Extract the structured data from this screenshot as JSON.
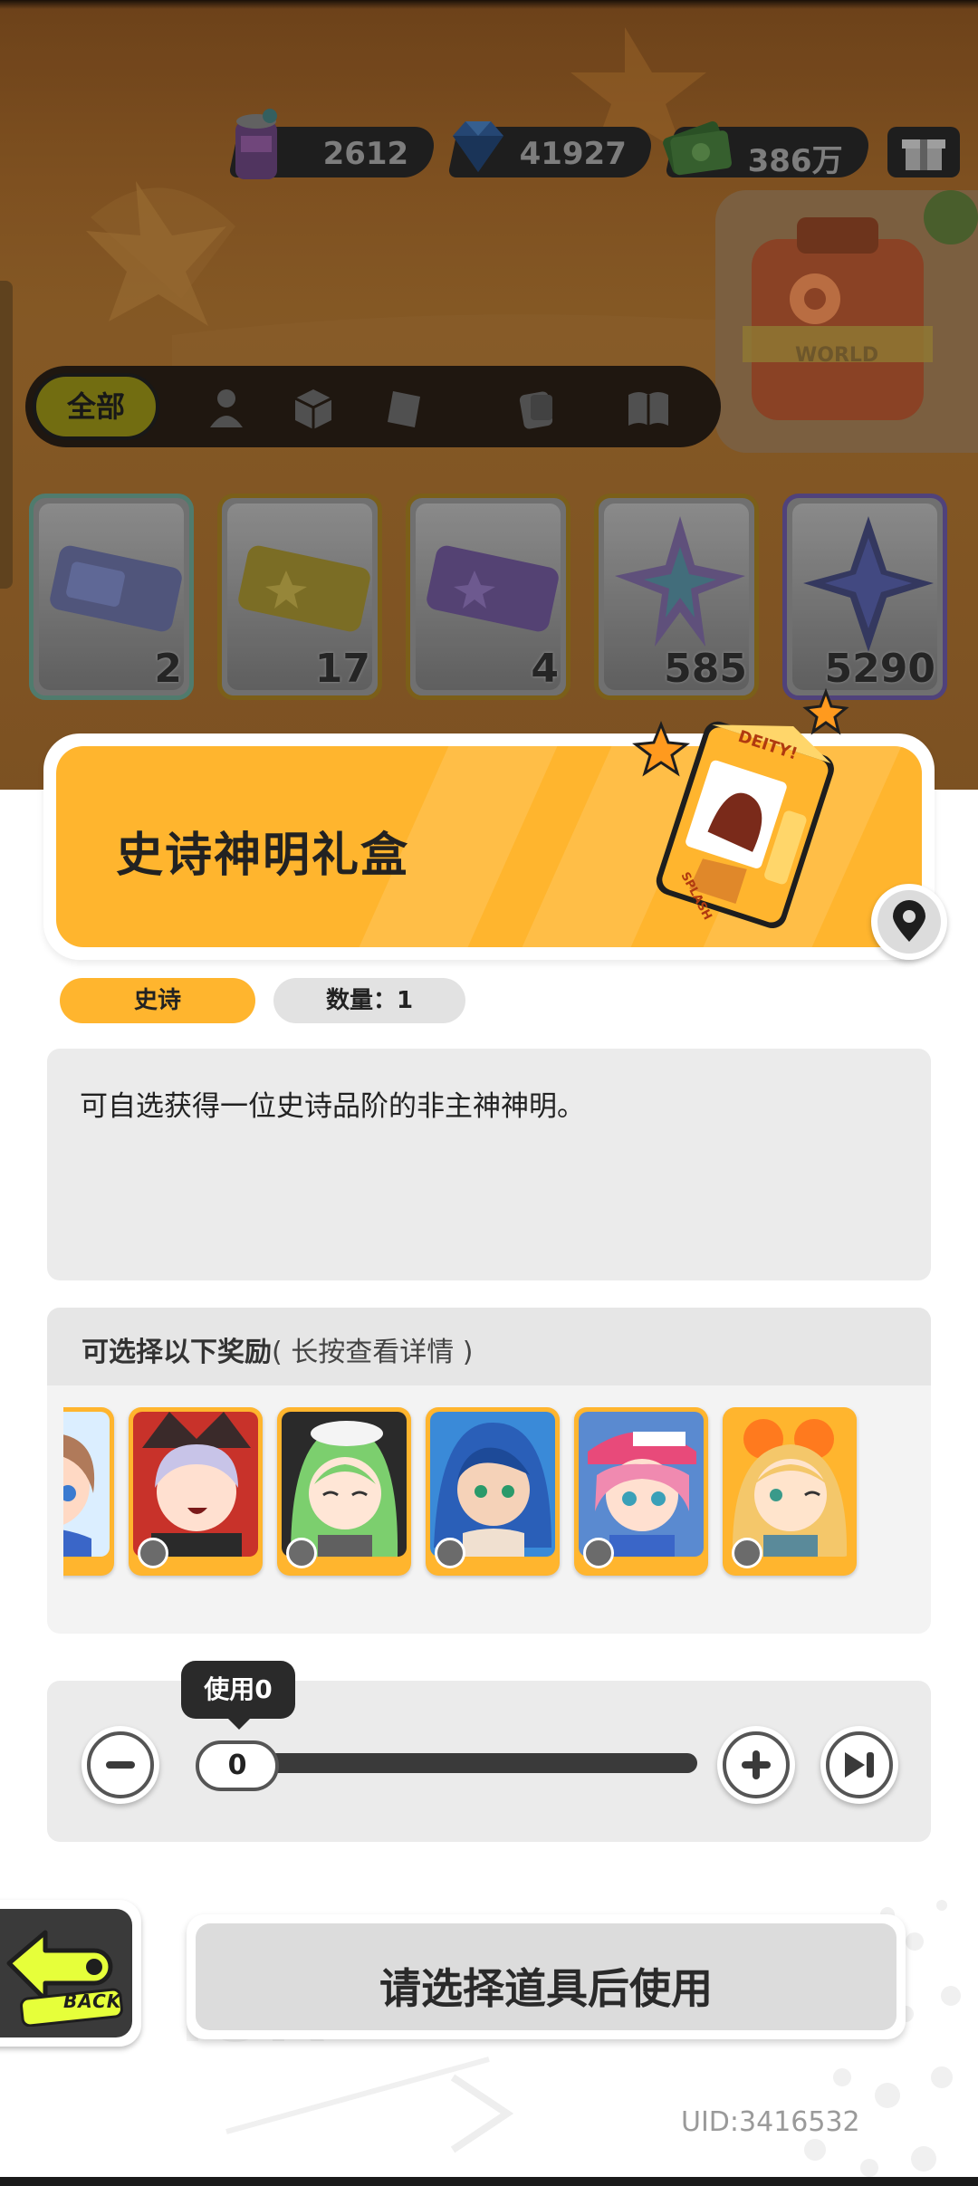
{
  "currencies": [
    {
      "icon": "soda-can-icon",
      "value": "2612"
    },
    {
      "icon": "gem-icon",
      "value": "41927"
    },
    {
      "icon": "cash-icon",
      "value": "386万"
    }
  ],
  "filter": {
    "all_label": "全部",
    "tabs": [
      "person-icon",
      "box-icon",
      "card-icon",
      "tarot-icon",
      "book-icon"
    ]
  },
  "world_card_label": "WORLD",
  "inventory": [
    {
      "count": "2",
      "color": "#7ec8e3"
    },
    {
      "count": "17",
      "color": "#e0c341"
    },
    {
      "count": "4",
      "color": "#9a78c8"
    },
    {
      "count": "585",
      "color": "#8fb8d8"
    },
    {
      "count": "5290",
      "color": "#6b7fd0"
    }
  ],
  "item": {
    "title": "史诗神明礼盒",
    "box_label_top": "DEITY!",
    "box_label_side": "SPLASH",
    "rarity": "史诗",
    "quantity_label": "数量：1",
    "description": "可自选获得一位史诗品阶的非主神神明。"
  },
  "rewards": {
    "title": "可选择以下奖励",
    "hint": "( 长按查看详情 )",
    "heroes": [
      {
        "name": "brown-hair-hero",
        "hair": "#b07a5a",
        "skin": "#ffd9c4"
      },
      {
        "name": "silver-hair-hero",
        "hair": "#c8c4e8",
        "skin": "#ffe0d0"
      },
      {
        "name": "green-hair-hero",
        "hair": "#7ccf6e",
        "skin": "#ffe6d6"
      },
      {
        "name": "blue-hair-hero",
        "hair": "#2a5fb8",
        "skin": "#f5d2b8"
      },
      {
        "name": "pink-cap-hero",
        "hair": "#f08ab0",
        "skin": "#ffe0d0"
      },
      {
        "name": "blonde-hero",
        "hair": "#f4c76a",
        "skin": "#ffe4cc"
      }
    ]
  },
  "slider": {
    "tooltip": "使用0",
    "value": "0",
    "level": 0
  },
  "back_label": "BACK",
  "use_button_label": "请选择道具后使用",
  "uid": "UID:3416532",
  "colors": {
    "accent": "#ffb52e",
    "panel": "#ffffff",
    "box": "#ebebeb"
  }
}
